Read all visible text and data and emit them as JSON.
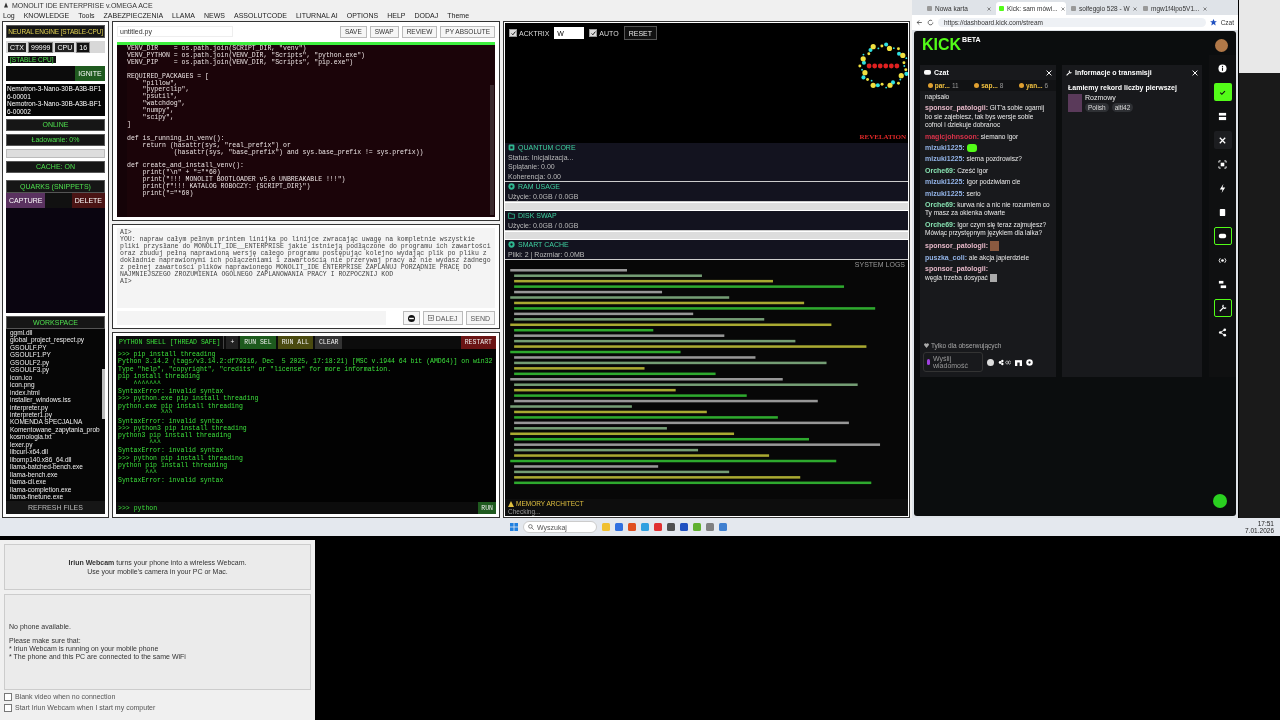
{
  "ide": {
    "title": "MONOLIT IDE ENTERPRISE v.OMEGA ACE",
    "menu": [
      "Log",
      "KNOWLEDGE",
      "Tools",
      "ZABEZPIECZENIA",
      "LLAMA",
      "NEWS",
      "ASSOLUTCODE",
      "LITURNAL AI",
      "OPTIONS",
      "HELP",
      "DODAJ",
      "Theme"
    ],
    "engine": {
      "title": "NEURAL ENGINE [STABLE-CPU]",
      "ctx_label": "CTX",
      "ctx_value": "99999",
      "cpu_label": "CPU",
      "cpu_value": "16",
      "badge": "[STABLE CPU]",
      "ignite": "IGNITE",
      "models": [
        "Nemotron-3-Nano-30B-A3B-BF16-00001",
        "Nemotron-3-Nano-30B-A3B-BF16-00002"
      ],
      "status": "ONLINE",
      "loading": "Ładowanie: 0%",
      "level": 0,
      "cache": "CACHE: ON"
    },
    "quarks": {
      "title": "QUARKS (SNIPPETS)",
      "capture": "CAPTURE",
      "delete": "DELETE"
    },
    "workspace": {
      "title": "WORKSPACE",
      "refresh": "REFRESH FILES",
      "files": [
        "ggml.dll",
        "global_project_respect.py",
        "GSOULF.PY",
        "GSOULF1.PY",
        "GSOULF2.py",
        "GSOULF3.py",
        "icon.ico",
        "icon.png",
        "index.html",
        "installer_windows.iss",
        "interpreter.py",
        "interpreter1.py",
        "KOMENDA SPECJALNA",
        "Komentowane_zapytania_prob",
        "kosmologia.txt",
        "lexer.py",
        "libcurl-x64.dll",
        "libomp140.x86_64.dll",
        "llama-batched-bench.exe",
        "llama-bench.exe",
        "llama-cli.exe",
        "llama-completion.exe",
        "llama-finetune.exe"
      ]
    },
    "editor": {
      "filename": "untitled.py",
      "buttons": [
        "SAVE",
        "SWAP",
        "REVIEW",
        "PY ABSOLUTE"
      ],
      "code": [
        {
          "text": "VENV_DIR    = os.path.join(SCRIPT_DIR, \"venv\")",
          "blank_before": false
        },
        {
          "text": "VENV_PYTHON = os.path.join(VENV_DIR, \"Scripts\", \"python.exe\")",
          "blank_before": false
        },
        {
          "text": "VENV_PIP    = os.path.join(VENV_DIR, \"Scripts\", \"pip.exe\")",
          "blank_before": false
        },
        {
          "text": "REQUIRED_PACKAGES = [",
          "blank_before": true
        },
        {
          "text": "    \"pillow\",",
          "blank_before": false
        },
        {
          "text": "    \"pyperclip\",",
          "blank_before": false
        },
        {
          "text": "    \"psutil\",",
          "blank_before": false
        },
        {
          "text": "    \"watchdog\",",
          "blank_before": false
        },
        {
          "text": "    \"numpy\",",
          "blank_before": false
        },
        {
          "text": "    \"scipy\",",
          "blank_before": false
        },
        {
          "text": "]",
          "blank_before": false
        },
        {
          "text": "def is_running_in_venv():",
          "blank_before": true
        },
        {
          "text": "    return (hasattr(sys, \"real_prefix\") or",
          "blank_before": false
        },
        {
          "text": "            (hasattr(sys, \"base_prefix\") and sys.base_prefix != sys.prefix))",
          "blank_before": false
        },
        {
          "text": "def create_and_install_venv():",
          "blank_before": true
        },
        {
          "text": "    print(\"\\n\" + \"=\"*60)",
          "blank_before": false
        },
        {
          "text": "    print(\"!!! MONOLIT BOOTLOADER v5.0 UNBREAKABLE !!!\")",
          "blank_before": false
        },
        {
          "text": "    print(f\"!!! KATALOG ROBOCZY: {SCRIPT_DIR}\")",
          "blank_before": false
        },
        {
          "text": "    print(\"=\"*60)",
          "blank_before": false
        }
      ]
    },
    "assistant": {
      "lines": [
        "AI>",
        "YOU: napraw całym pełnym printem linijka po linijce zwracając uwagę na kompletnie wszystkie pliki przysłane do MONOLIT_IDE__ENTERPRISE jakie istnieją podłączone do programu ich zawartości oraz zbuduj pełną naprawioną wersję całego programu postępując kolejno wydając plik po pliku z dokładnie naprawionymi ich połączeniami i zawartością nie przerywaj pracy aż nie wydasz żadnego z pełnej zawartości plików naprawionego MONOLIT_IDE ENTERPRISE ZAPLANUJ PORZĄDNIE PRACĘ DO NAJMNIEJSZEGO ZROZUMIENIA OGÓLNEGO ZAPLANOWANIA PRACY I ROZPOCZNIJ KOD",
        "AI>"
      ],
      "next": "DALEJ",
      "send": "SEND"
    },
    "shell": {
      "title": "PYTHON SHELL [THREAD SAFE]",
      "plus": "+",
      "run_sel": "RUN SEL",
      "run_all": "RUN ALL",
      "clear": "CLEAR",
      "restart": "RESTART",
      "prompt": ">>>",
      "input": "python",
      "run": "RUN",
      "lines": [
        ">>> pip install threading",
        "Python 3.14.2 (tags/v3.14.2:df79316, Dec  5 2025, 17:18:21) [MSC v.1944 64 bit (AMD64)] on win32",
        "Type \"help\", \"copyright\", \"credits\" or \"license\" for more information.",
        "pip install threading",
        "    ^^^^^^^",
        "SyntaxError: invalid syntax",
        ">>> python.exe pip install threading",
        "python.exe pip install threading",
        "           ^^^",
        "SyntaxError: invalid syntax",
        ">>> python3 pip install threading",
        "python3 pip install threading",
        "        ^^^",
        "SyntaxError: invalid syntax",
        ">>> python pip install threading",
        "python pip install threading",
        "       ^^^",
        "SyntaxError: invalid syntax"
      ]
    },
    "monitor": {
      "checks": [
        {
          "label": "ACKTRIX",
          "checked": true
        },
        {
          "label": "AUTO",
          "checked": true
        }
      ],
      "mode": "W",
      "reset": "RESET",
      "viz_label": "REVELATION",
      "cards": [
        {
          "kind": "core",
          "title": "QUANTUM CORE",
          "lines": [
            "Status: Inicjalizacja...",
            "Splątanie: 0.00",
            "Koherencja: 0.00"
          ]
        },
        {
          "kind": "meter",
          "title": "RAM USAGE",
          "lines": [
            "Użycie: 0.0GB / 0.0GB"
          ],
          "level": 0
        },
        {
          "kind": "disk",
          "title": "DISK SWAP",
          "lines": [
            "Użycie: 0.0GB / 0.0GB"
          ],
          "level": 0
        },
        {
          "kind": "cache",
          "title": "SMART CACHE",
          "lines": [
            "Pliki: 2 | Rozmiar: 0.0MB"
          ]
        }
      ],
      "logs_title": "SYSTEM LOGS",
      "memory_title": "MEMORY ARCHITECT",
      "memory_status": "Checking..."
    }
  },
  "browser": {
    "tabs": [
      {
        "label": "Nowa karta",
        "selected": false
      },
      {
        "label": "Kick: sam mówi...",
        "selected": true
      },
      {
        "label": "solfeggio 528 - W",
        "selected": false
      },
      {
        "label": "mgw1f4lpo5V1...",
        "selected": false
      }
    ],
    "url": "https://dashboard.kick.com/stream",
    "copilot": "Czat",
    "logo": "KICK",
    "logo_badge": "BETA",
    "chat": {
      "title": "Czat",
      "top": [
        {
          "name": "par...",
          "count": "11"
        },
        {
          "name": "sap...",
          "count": "8"
        },
        {
          "name": "yan...",
          "count": "6"
        }
      ],
      "messages": [
        {
          "kind": "text",
          "text": "napisało"
        },
        {
          "kind": "msg",
          "user": "sponsor_patologii:",
          "color": "#e6b8c8",
          "text": "GIT'a sobie ogarnij bo sie zajebiesz, tak bys wersje sobie cofnol i dziekuje dobranoc"
        },
        {
          "kind": "msg",
          "user": "magicjohnsoon:",
          "color": "#d8324a",
          "text": "siemano igor"
        },
        {
          "kind": "emote",
          "user": "mizuki1225:",
          "color": "#93b4e8"
        },
        {
          "kind": "msg",
          "user": "mizuki1225:",
          "color": "#93b4e8",
          "text": "siema pozdrowisz?"
        },
        {
          "kind": "msg",
          "user": "Orche69:",
          "color": "#86e0b0",
          "text": "Cześć Igor"
        },
        {
          "kind": "msg",
          "user": "mizuki1225:",
          "color": "#93b4e8",
          "text": "Igor podziwiam cie"
        },
        {
          "kind": "msg",
          "user": "mizuki1225:",
          "color": "#93b4e8",
          "text": "serio"
        },
        {
          "kind": "msg",
          "user": "Orche69:",
          "color": "#86e0b0",
          "text": "kurwa nic a nic nie rozumiem co Ty masz za okienka otwarte"
        },
        {
          "kind": "msg",
          "user": "Orche69:",
          "color": "#86e0b0",
          "text": "Igor czym się teraz zajmujesz? Mówiąc przystępnym językiem dla laika?"
        },
        {
          "kind": "image",
          "user": "sponsor_patologii:",
          "color": "#e6b8c8"
        },
        {
          "kind": "msg",
          "user": "puszka_coli:",
          "color": "#93b4e8",
          "text": "ale akcja japierdziele"
        },
        {
          "kind": "msg_emote",
          "user": "sponsor_patologii:",
          "color": "#e6b8c8",
          "text": "węgla trzeba dosypać"
        }
      ],
      "followers_only": "Tylko dla obserwujących",
      "placeholder": "Wyślij wiadomość"
    },
    "info": {
      "title": "Informacje o transmisji",
      "stream_title": "Łamiemy rekord liczby pierwszej",
      "category": "Rozmowy",
      "tags": [
        "Polish",
        "altl42"
      ]
    },
    "sidebar": [
      {
        "kind": "plain"
      },
      {
        "kind": "filled"
      },
      {
        "kind": "plain"
      },
      {
        "kind": "boxed"
      },
      {
        "kind": "plain"
      },
      {
        "kind": "plain"
      },
      {
        "kind": "plain"
      },
      {
        "kind": "outlined"
      },
      {
        "kind": "plain"
      },
      {
        "kind": "plain"
      },
      {
        "kind": "outlined"
      },
      {
        "kind": "plain"
      }
    ]
  },
  "taskbar": {
    "search": "Wyszukaj",
    "time": "17:51",
    "date": "7.01.2026"
  },
  "webcam": {
    "intro": "**Iriun Webcam** turns your phone into a wireless Webcam.",
    "intro2": "Use your mobile's camera in your PC or Mac.",
    "status": "No phone available.",
    "hint": "Please make sure that:",
    "points": [
      "* Iriun Webcam is running on your mobile phone",
      "* The phone and this PC are connected to the same WiFi"
    ],
    "options": [
      {
        "label": "Blank video when no connection",
        "checked": false
      },
      {
        "label": "Start Iriun Webcam when I start my computer",
        "checked": false
      }
    ]
  }
}
